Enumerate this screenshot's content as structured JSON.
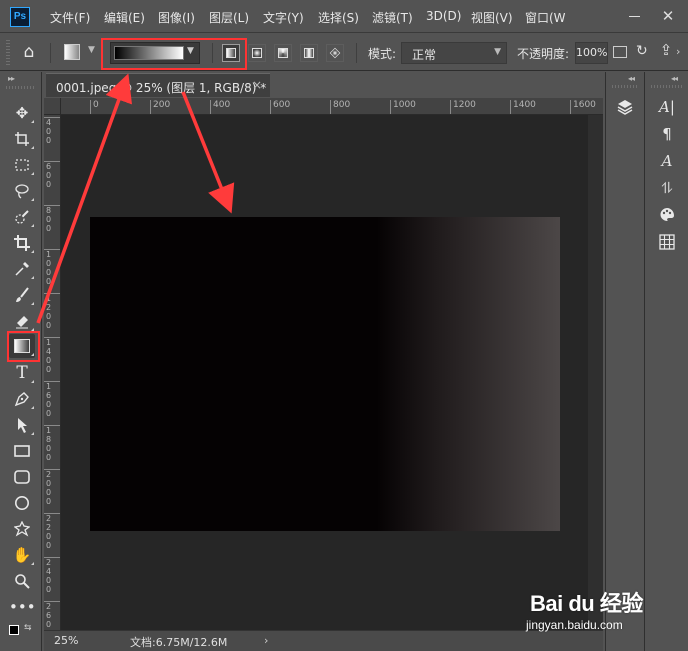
{
  "app": {
    "logo_text": "Ps"
  },
  "menu": {
    "items": [
      "文件(F)",
      "编辑(E)",
      "图像(I)",
      "图层(L)",
      "文字(Y)",
      "选择(S)",
      "滤镜(T)",
      "3D(D)",
      "视图(V)",
      "窗口(W"
    ]
  },
  "options_bar": {
    "gradient_types": [
      "linear",
      "radial",
      "angle",
      "reflected",
      "diamond"
    ],
    "selected_gradient_type": "linear",
    "mode_label": "模式:",
    "mode_value": "正常",
    "opacity_label": "不透明度:",
    "opacity_value": "100%"
  },
  "document_tab": {
    "title": "0001.jpeg @ 25% (图层 1, RGB/8) *",
    "close_symbol": "×"
  },
  "rulers": {
    "horizontal_labels": [
      "0",
      "200",
      "400",
      "600",
      "800",
      "1000",
      "1200",
      "1400",
      "1600"
    ],
    "vertical_labels": [
      "400",
      "600",
      "800",
      "1000",
      "1200",
      "1400",
      "1600",
      "1800",
      "2000",
      "2200",
      "2400",
      "2600"
    ]
  },
  "status_bar": {
    "zoom": "25%",
    "doc_info": "文档:6.75M/12.6M",
    "arrow": "›"
  },
  "toolbar": {
    "tools": [
      "move",
      "artboard",
      "marquee",
      "lasso",
      "quick-selection",
      "crop",
      "eyedropper",
      "brush",
      "eraser",
      "gradient",
      "type",
      "pen",
      "path-selection",
      "rectangle",
      "rounded-rectangle",
      "ellipse",
      "custom-shape",
      "hand",
      "zoom",
      "more"
    ],
    "active_tool": "gradient"
  },
  "colors": {
    "foreground": "#000000",
    "background": "#ffffff",
    "highlight": "#ff3333",
    "image_dark": "#050203",
    "image_light": "#4c4747"
  },
  "watermark": {
    "brand": "Bai du 经验",
    "url": "jingyan.baidu.com"
  }
}
